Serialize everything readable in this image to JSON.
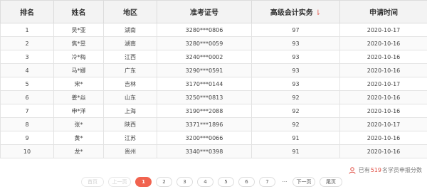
{
  "table": {
    "headers": {
      "rank": "排名",
      "name": "姓名",
      "region": "地区",
      "ticket": "准考证号",
      "score": "高级会计实务",
      "date": "申请时间"
    },
    "rows": [
      {
        "rank": "1",
        "name": "吴*亚",
        "region": "湖南",
        "ticket": "3280***0806",
        "score": "97",
        "date": "2020-10-17"
      },
      {
        "rank": "2",
        "name": "焦*昱",
        "region": "湖南",
        "ticket": "3280***0059",
        "score": "93",
        "date": "2020-10-16"
      },
      {
        "rank": "3",
        "name": "冷*梅",
        "region": "江西",
        "ticket": "3240***0002",
        "score": "93",
        "date": "2020-10-16"
      },
      {
        "rank": "4",
        "name": "马*娜",
        "region": "广东",
        "ticket": "3290***0591",
        "score": "93",
        "date": "2020-10-16"
      },
      {
        "rank": "5",
        "name": "宋*",
        "region": "吉林",
        "ticket": "3170***0144",
        "score": "93",
        "date": "2020-10-17"
      },
      {
        "rank": "6",
        "name": "姜*焱",
        "region": "山东",
        "ticket": "3250***0813",
        "score": "92",
        "date": "2020-10-16"
      },
      {
        "rank": "7",
        "name": "申*洋",
        "region": "上海",
        "ticket": "3190***2088",
        "score": "92",
        "date": "2020-10-16"
      },
      {
        "rank": "8",
        "name": "张*",
        "region": "陕西",
        "ticket": "3371***1896",
        "score": "92",
        "date": "2020-10-17"
      },
      {
        "rank": "9",
        "name": "黄*",
        "region": "江苏",
        "ticket": "3200***0066",
        "score": "91",
        "date": "2020-10-16"
      },
      {
        "rank": "10",
        "name": "龙*",
        "region": "贵州",
        "ticket": "3340***0398",
        "score": "91",
        "date": "2020-10-16"
      }
    ]
  },
  "sort_icon": {
    "name": "sort-down-icon",
    "glyph": "⇂",
    "color": "#e45a4f"
  },
  "note": {
    "prefix": "已有",
    "count": "519",
    "suffix": "名学员申报分数",
    "icon": "person-icon",
    "accent": "#e04a3f"
  },
  "pager": {
    "first": "首页",
    "prev": "上一页",
    "pages": [
      "1",
      "2",
      "3",
      "4",
      "5",
      "6",
      "7"
    ],
    "ellipsis": "···",
    "next": "下一页",
    "last": "尾页",
    "current": "1",
    "active_color": "#f1634f"
  }
}
